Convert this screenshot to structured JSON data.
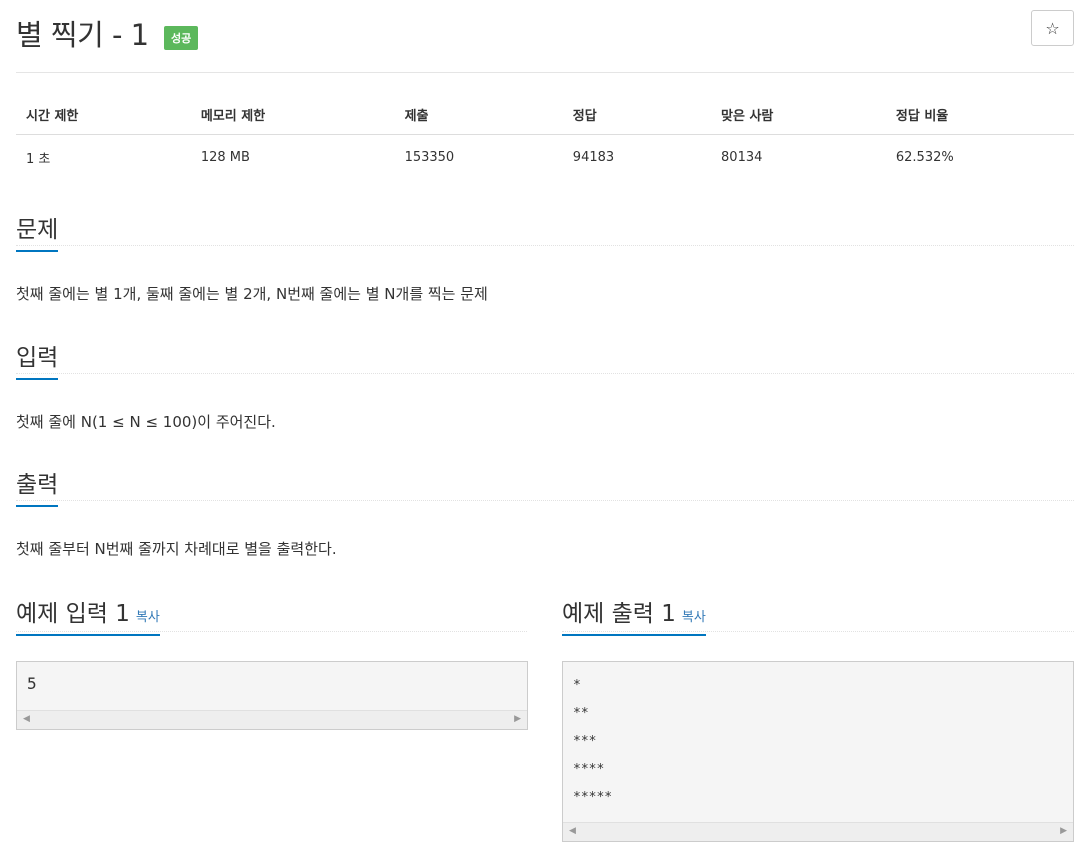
{
  "header": {
    "title": "별 찍기 - 1",
    "badge": "성공",
    "star": "☆"
  },
  "stats": {
    "headers": [
      "시간 제한",
      "메모리 제한",
      "제출",
      "정답",
      "맞은 사람",
      "정답 비율"
    ],
    "values": [
      "1 초",
      "128 MB",
      "153350",
      "94183",
      "80134",
      "62.532%"
    ]
  },
  "sections": {
    "problem": {
      "heading": "문제",
      "text": "첫째 줄에는 별 1개, 둘째 줄에는 별 2개, N번째 줄에는 별 N개를 찍는 문제"
    },
    "input": {
      "heading": "입력",
      "text": "첫째 줄에 N(1 ≤ N ≤ 100)이 주어진다."
    },
    "output": {
      "heading": "출력",
      "text": "첫째 줄부터 N번째 줄까지 차례대로 별을 출력한다."
    }
  },
  "samples": {
    "input": {
      "heading": "예제 입력 1",
      "copy": "복사",
      "lines": [
        "5"
      ]
    },
    "output": {
      "heading": "예제 출력 1",
      "copy": "복사",
      "lines": [
        "*",
        "**",
        "***",
        "****",
        "*****"
      ]
    }
  }
}
